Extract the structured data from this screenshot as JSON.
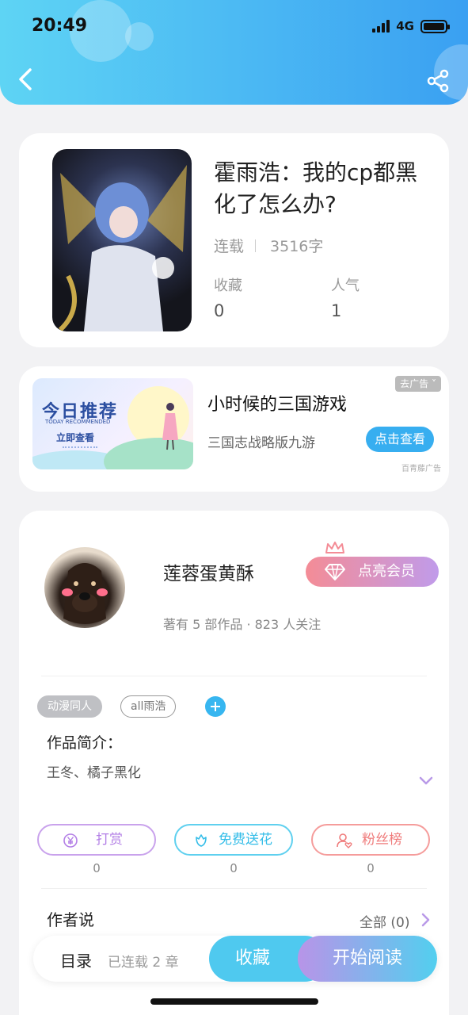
{
  "status_bar": {
    "time": "20:49",
    "network": "4G",
    "battery_level": 1.0
  },
  "nav": {
    "back_icon": "chevron-left-icon",
    "share_icon": "share-icon"
  },
  "book": {
    "title": "霍雨浩：我的cp都黑化了怎么办?",
    "status": "连载",
    "word_count": "3516字",
    "favorites_label": "收藏",
    "favorites_value": "0",
    "popularity_label": "人气",
    "popularity_value": "1"
  },
  "ad": {
    "image_heading": "今日推荐",
    "image_subheading": "TODAY RECOMMENDED",
    "image_cta": "立即查看",
    "title": "小时候的三国游戏",
    "subtitle": "三国志战略版九游",
    "close_label": "去广告",
    "button_label": "点击查看",
    "source": "百青藤广告"
  },
  "author": {
    "name": "莲蓉蛋黄酥",
    "info": "著有 5 部作品 · 823 人关注",
    "vip_button": "点亮会员"
  },
  "tags": [
    "动漫同人",
    "all雨浩"
  ],
  "intro": {
    "label": "作品简介：",
    "text": "王冬、橘子黑化"
  },
  "actions": [
    {
      "label": "打赏",
      "count": "0",
      "icon": "yen-coin-icon"
    },
    {
      "label": "免费送花",
      "count": "0",
      "icon": "flower-icon"
    },
    {
      "label": "粉丝榜",
      "count": "0",
      "icon": "fan-heart-icon"
    }
  ],
  "author_says": {
    "label": "作者说",
    "all": "全部 (0)"
  },
  "bottom_bar": {
    "toc": "目录",
    "chapters": "已连载 2 章",
    "favorite": "收藏",
    "start_reading": "开始阅读"
  },
  "colors": {
    "accent": "#37b6f0",
    "vip_start": "#f48c96",
    "vip_end": "#c09bea"
  }
}
